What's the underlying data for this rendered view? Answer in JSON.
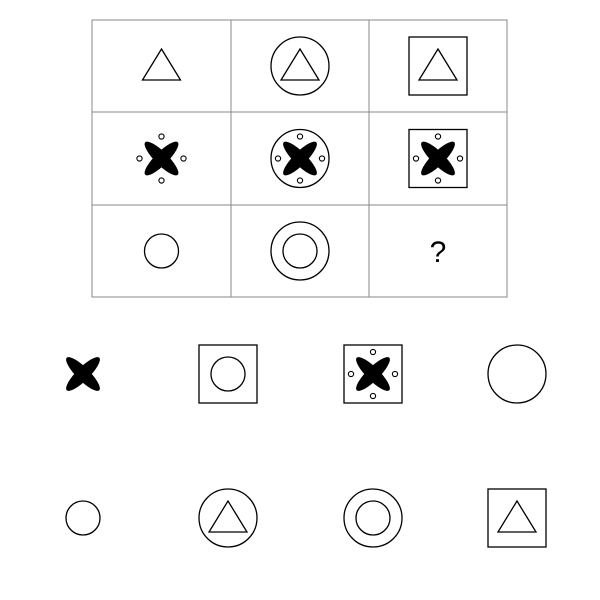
{
  "puzzle": {
    "grid": {
      "rows": [
        [
          {
            "id": "r1c1",
            "shapes": [
              "triangle"
            ]
          },
          {
            "id": "r1c2",
            "shapes": [
              "triangle",
              "circle-frame"
            ]
          },
          {
            "id": "r1c3",
            "shapes": [
              "triangle",
              "square-frame"
            ]
          }
        ],
        [
          {
            "id": "r2c1",
            "shapes": [
              "x-petals",
              "dots"
            ]
          },
          {
            "id": "r2c2",
            "shapes": [
              "x-petals",
              "dots",
              "circle-frame"
            ]
          },
          {
            "id": "r2c3",
            "shapes": [
              "x-petals",
              "dots",
              "square-frame"
            ]
          }
        ],
        [
          {
            "id": "r3c1",
            "shapes": [
              "small-circle"
            ]
          },
          {
            "id": "r3c2",
            "shapes": [
              "small-circle",
              "circle-frame"
            ]
          },
          {
            "id": "r3c3",
            "shapes": [
              "question"
            ]
          }
        ]
      ]
    },
    "question_mark": "?",
    "options": [
      {
        "id": "opt1",
        "shapes": [
          "x-petals"
        ]
      },
      {
        "id": "opt2",
        "shapes": [
          "small-circle",
          "square-frame"
        ]
      },
      {
        "id": "opt3",
        "shapes": [
          "x-petals",
          "dots",
          "square-frame"
        ]
      },
      {
        "id": "opt4",
        "shapes": [
          "large-circle"
        ]
      },
      {
        "id": "opt5",
        "shapes": [
          "small-circle"
        ]
      },
      {
        "id": "opt6",
        "shapes": [
          "triangle",
          "circle-frame"
        ]
      },
      {
        "id": "opt7",
        "shapes": [
          "small-circle",
          "circle-frame"
        ]
      },
      {
        "id": "opt8",
        "shapes": [
          "triangle",
          "square-frame"
        ]
      }
    ],
    "colors": {
      "stroke": "#000000",
      "grid_line": "#888888",
      "background": "#ffffff"
    }
  }
}
